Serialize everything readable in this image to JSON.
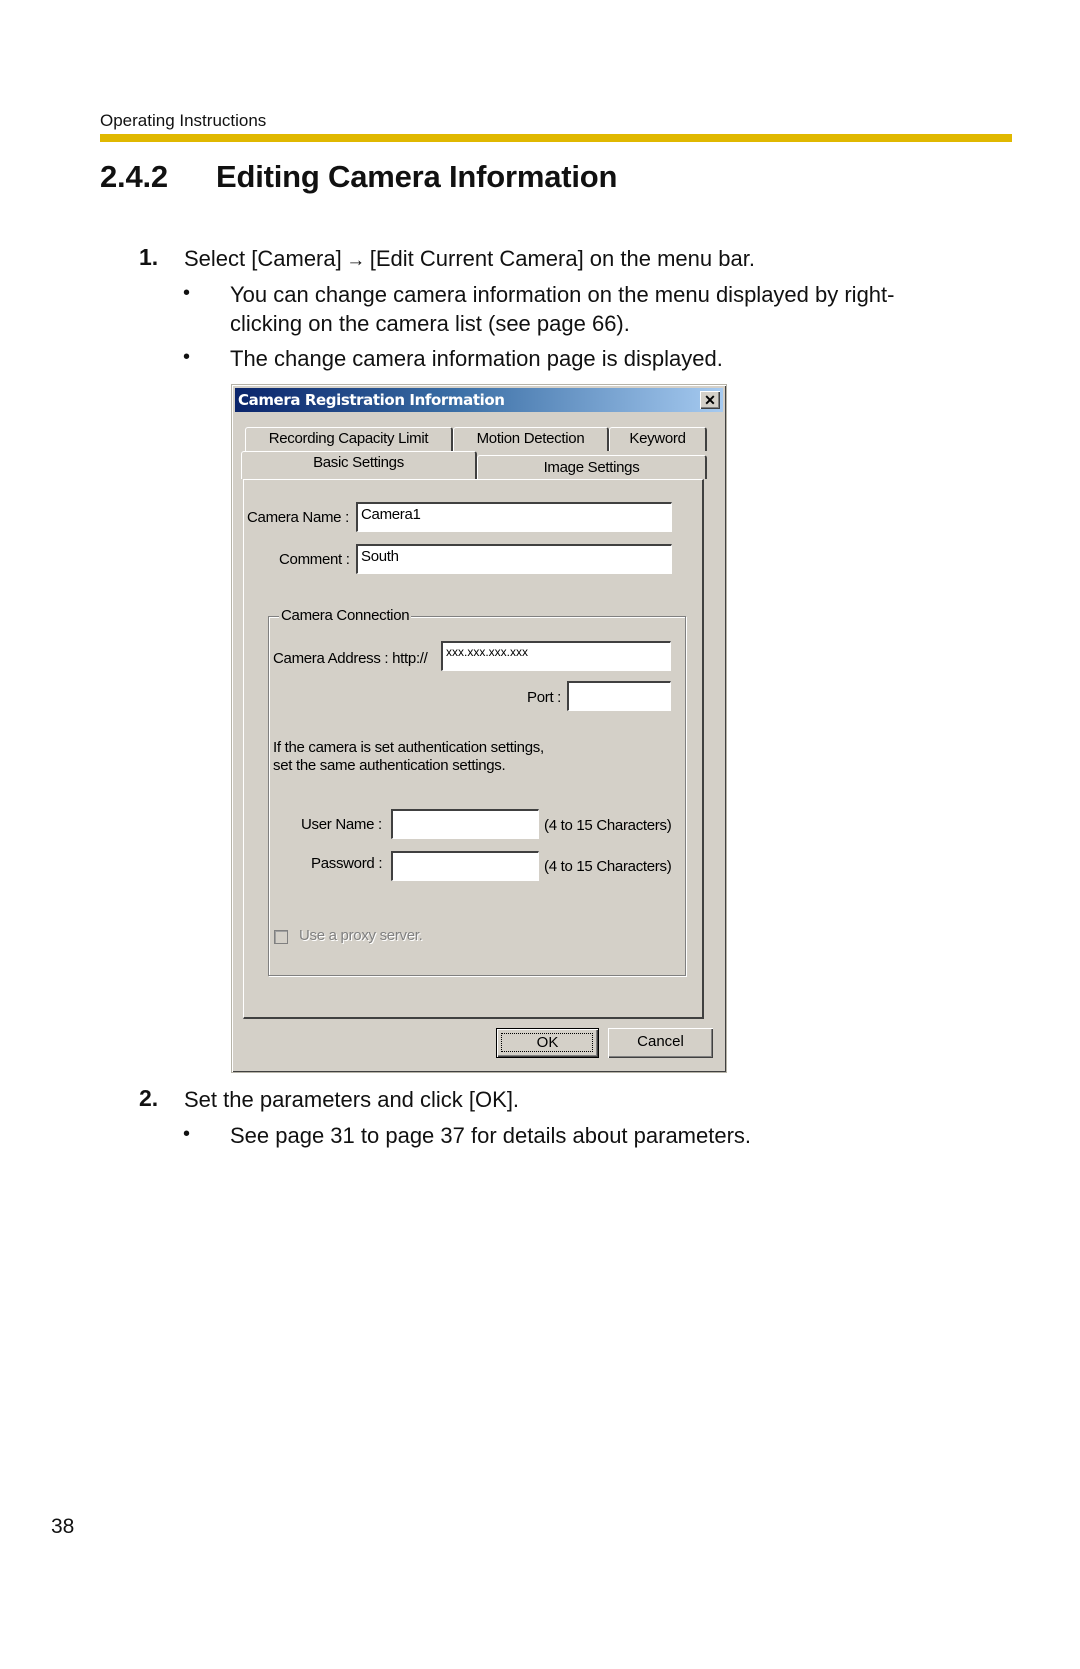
{
  "header": {
    "running_head": "Operating Instructions",
    "accent_color": "#e0b800"
  },
  "section": {
    "number": "2.4.2",
    "title": "Editing Camera Information"
  },
  "steps": [
    {
      "number": "1.",
      "text_before_arrow": "Select [Camera]",
      "arrow": "→",
      "text_after_arrow": "[Edit Current Camera] on the menu bar.",
      "bullets": [
        {
          "line1": "You can change camera information on the menu displayed by right-",
          "line2": "clicking on the camera list (see page 66)."
        },
        {
          "line1": "The change camera information page is displayed."
        }
      ]
    },
    {
      "number": "2.",
      "text": "Set the parameters and click [OK].",
      "bullets": [
        {
          "line1": "See page 31 to page 37 for details about parameters."
        }
      ]
    }
  ],
  "bullet_glyph": "•",
  "dialog": {
    "title": "Camera Registration Information",
    "close_glyph": "✕",
    "tabs_row1": [
      "Recording Capacity Limit",
      "Motion Detection",
      "Keyword"
    ],
    "tabs_row2": [
      "Basic Settings",
      "Image Settings"
    ],
    "active_tab": "Basic Settings",
    "fields": {
      "camera_name_label": "Camera Name :",
      "camera_name_value": "Camera1",
      "comment_label": "Comment :",
      "comment_value": "South"
    },
    "connection": {
      "legend": "Camera Connection",
      "address_label": "Camera Address : http://",
      "address_value": "xxx.xxx.xxx.xxx",
      "port_label": "Port :",
      "port_value": "",
      "auth_note_line1": "If the camera is set authentication settings,",
      "auth_note_line2": "set the same authentication settings.",
      "username_label": "User Name :",
      "username_value": "",
      "username_hint": "(4 to 15 Characters)",
      "password_label": "Password :",
      "password_value": "",
      "password_hint": "(4 to 15 Characters)",
      "proxy_label": "Use a proxy server.",
      "proxy_checked": false
    },
    "buttons": {
      "ok": "OK",
      "cancel": "Cancel"
    }
  },
  "footer": {
    "page_number": "38"
  }
}
